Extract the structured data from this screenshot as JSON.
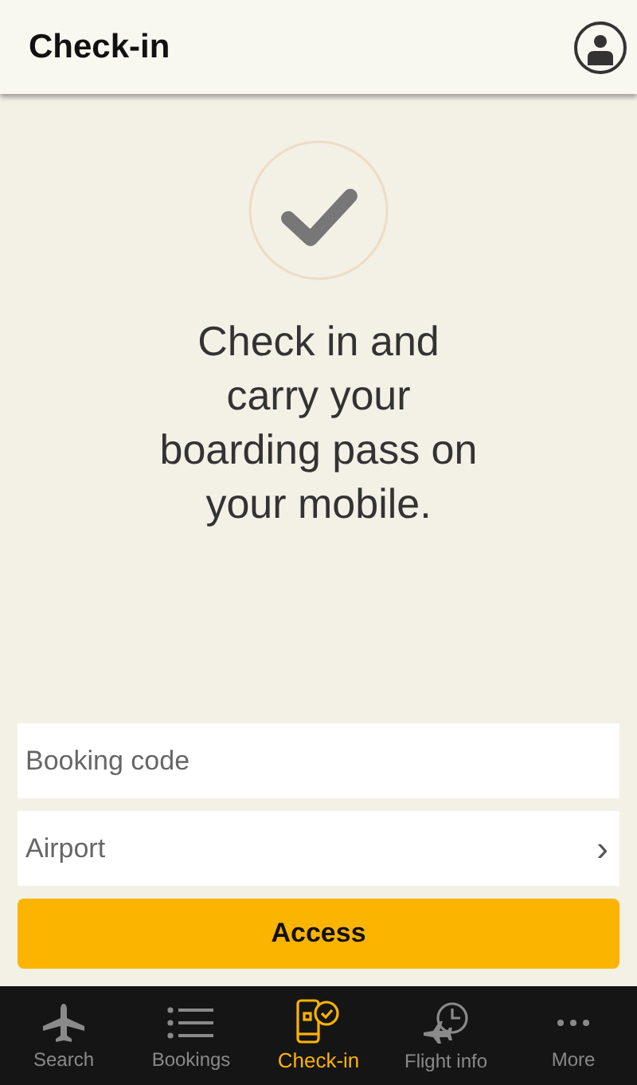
{
  "header": {
    "title": "Check-in"
  },
  "message": "Check in and carry your boarding pass on your mobile.",
  "form": {
    "booking_code": {
      "placeholder": "Booking code"
    },
    "airport": {
      "placeholder": "Airport",
      "chevron": "›"
    },
    "submit": "Access"
  },
  "tabs": [
    {
      "kind": "plane",
      "label": "Search",
      "selected": false
    },
    {
      "kind": "list",
      "label": "Bookings",
      "selected": false
    },
    {
      "kind": "phone",
      "label": "Check-in",
      "selected": true
    },
    {
      "kind": "clock",
      "label": "Flight info",
      "selected": false
    },
    {
      "kind": "dots",
      "label": "More",
      "selected": false
    }
  ]
}
